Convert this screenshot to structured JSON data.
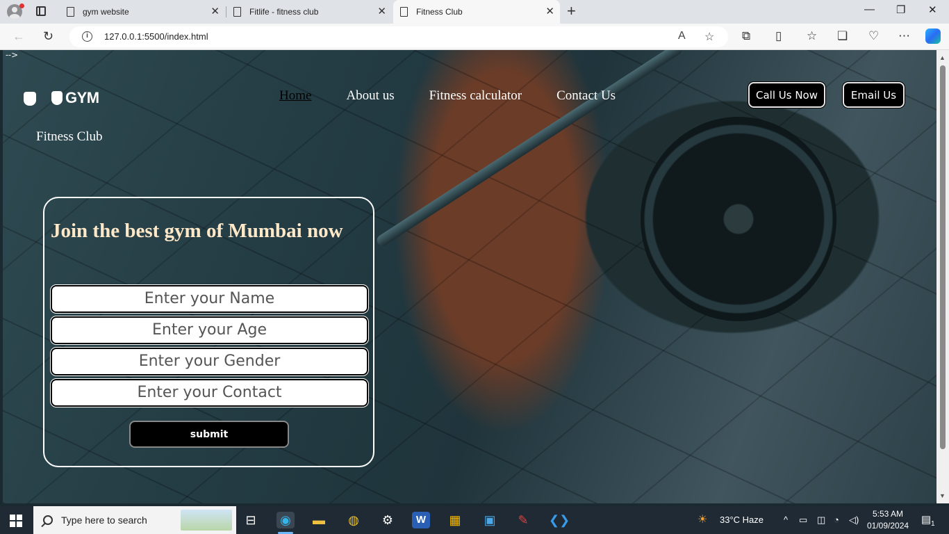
{
  "browser": {
    "tabs": [
      {
        "title": "gym website"
      },
      {
        "title": "Fitlife - fitness club"
      },
      {
        "title": "Fitness Club"
      }
    ],
    "url": "127.0.0.1:5500/index.html"
  },
  "page": {
    "stray_text": "-->",
    "logo_text": "GYM",
    "brand_subtitle": "Fitness Club",
    "nav": [
      "Home",
      "About us",
      "Fitness calculator",
      "Contact Us"
    ],
    "call_button": "Call Us Now",
    "email_button": "Email Us",
    "form": {
      "title": "Join the best gym of Mumbai now",
      "fields": [
        "Enter your Name",
        "Enter your Age",
        "Enter your Gender",
        "Enter your Contact"
      ],
      "submit_label": "submit"
    }
  },
  "taskbar": {
    "search_placeholder": "Type here to search",
    "weather": "33°C  Haze",
    "time": "5:53 AM",
    "date": "01/09/2024",
    "notification_count": "1"
  },
  "colors": {
    "accent_title": "#ffe9c8",
    "button_bg": "#000000",
    "taskbar_bg": "#1f2a35"
  }
}
